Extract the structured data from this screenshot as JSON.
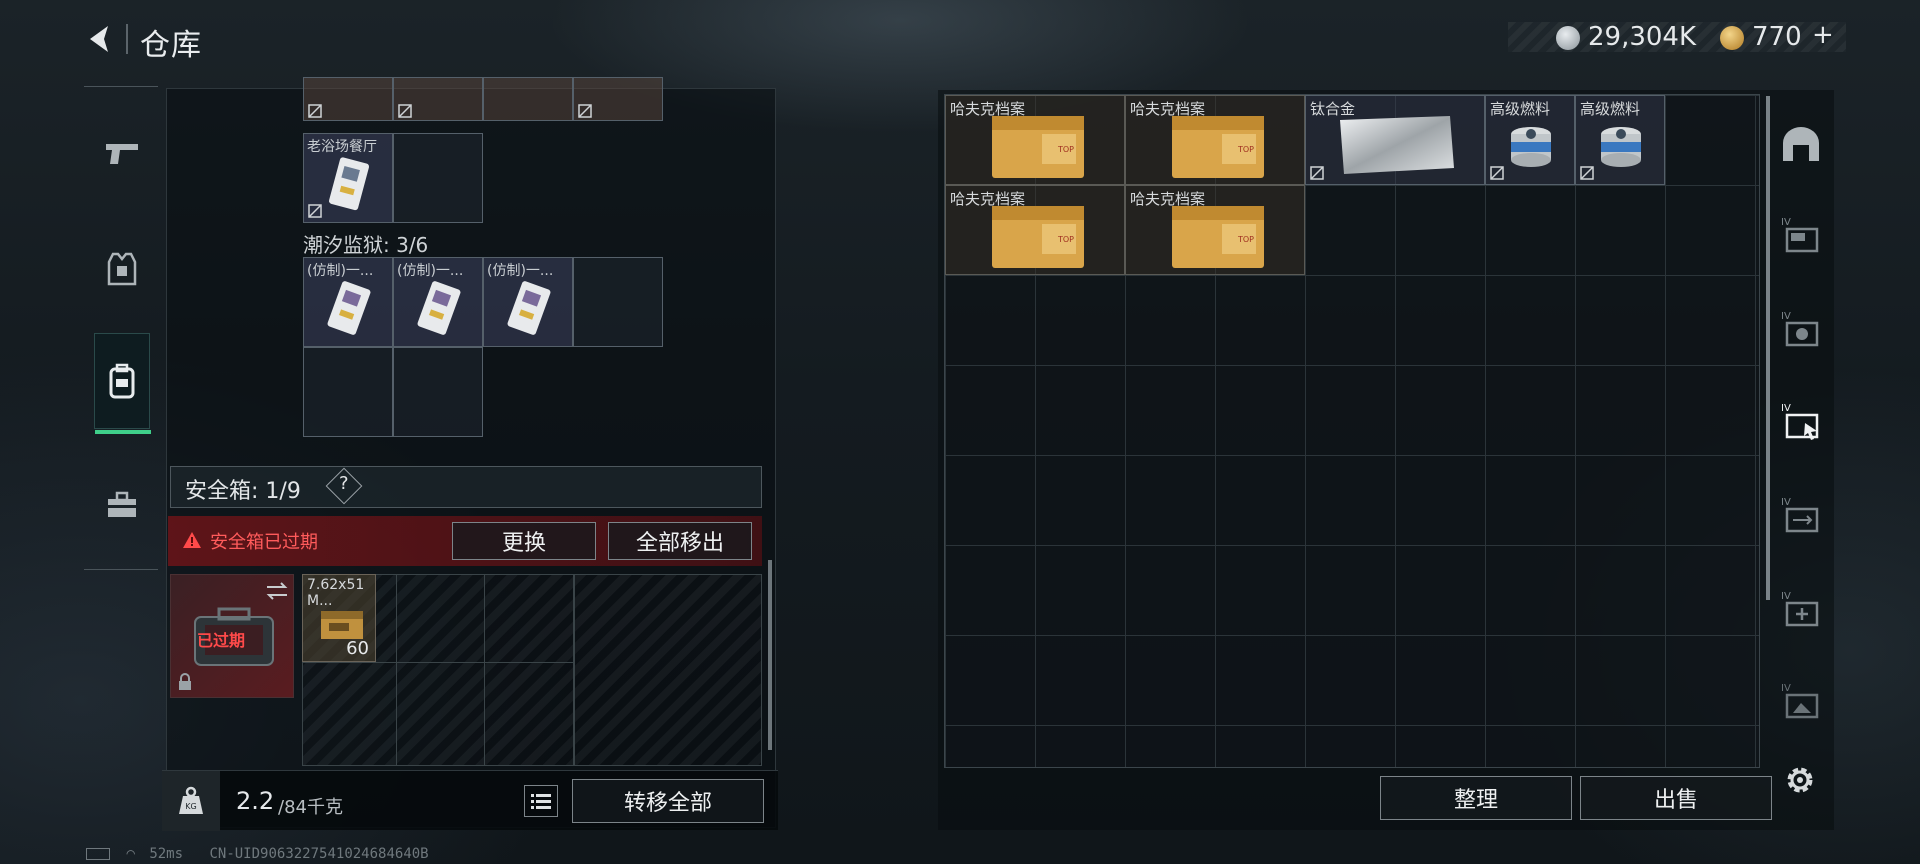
{
  "header": {
    "title": "仓库",
    "currency_primary": "29,304K",
    "currency_secondary": "770",
    "add_symbol": "+"
  },
  "left_nav": {
    "items": [
      {
        "icon": "pistol-icon"
      },
      {
        "icon": "armor-vest-icon"
      },
      {
        "icon": "backpack-icon",
        "active": true
      },
      {
        "icon": "toolbox-icon"
      }
    ]
  },
  "left_panel": {
    "top_item_label": "老浴场餐厅",
    "section_label": "潮汐监狱: 3/6",
    "prison_items": [
      "(仿制)一...",
      "(仿制)一...",
      "(仿制)一..."
    ],
    "safebox_label": "安全箱: 1/9",
    "help_symbol": "?",
    "expired_warning": "安全箱已过期",
    "expired_stamp": "已过期",
    "replace_button": "更换",
    "move_all_out_button": "全部移出",
    "ammo_label": "7.62x51",
    "ammo_sub": "M...",
    "ammo_count": "60",
    "weight_value": "2.2",
    "weight_capacity": "/84千克",
    "transfer_all_button": "转移全部"
  },
  "right_panel": {
    "items": [
      {
        "label": "哈夫克档案",
        "type": "file"
      },
      {
        "label": "哈夫克档案",
        "type": "file"
      },
      {
        "label": "钛合金",
        "type": "metal"
      },
      {
        "label": "高级燃料",
        "type": "fuel"
      },
      {
        "label": "高级燃料",
        "type": "fuel"
      },
      {
        "label": "哈夫克档案",
        "type": "file"
      },
      {
        "label": "哈夫克档案",
        "type": "file"
      }
    ],
    "sort_button": "整理",
    "sell_button": "出售"
  },
  "right_nav": {
    "items": [
      {
        "icon": "bunker-icon"
      },
      {
        "icon": "folder-storage-icon",
        "tier": "IV"
      },
      {
        "icon": "camera-storage-icon",
        "tier": "IV"
      },
      {
        "icon": "storage-select-icon",
        "tier": "IV"
      },
      {
        "icon": "storage-transfer-icon",
        "tier": "IV"
      },
      {
        "icon": "storage-add-icon",
        "tier": "IV"
      },
      {
        "icon": "storage-locked-icon",
        "tier": "IV"
      }
    ]
  },
  "status_bar": {
    "ping": "52ms",
    "uid": "CN-UID9063227541024684640B"
  },
  "colors": {
    "accent_green": "#3fcf8a",
    "warning_red": "#e23a3a",
    "expired_bg": "#7a1418"
  }
}
